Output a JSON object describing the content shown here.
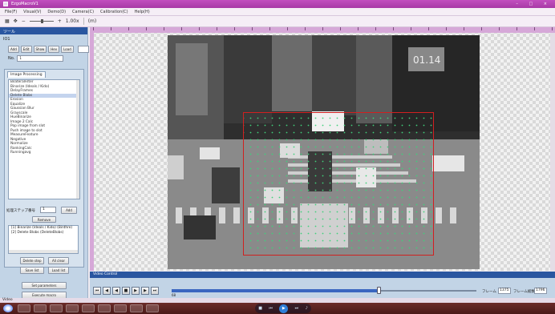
{
  "window": {
    "title": "EzgoMacroV1",
    "controls": "– □ ×"
  },
  "menu": [
    "File(F)",
    "Visual(V)",
    "Demo(D)",
    "Camera(C)",
    "Calibration(C)",
    "Help(H)"
  ],
  "toolbar": {
    "zoom_label": "1.00x",
    "extra_label": "(m)"
  },
  "left_panel": {
    "header": "ツール",
    "tool_label": "IO1",
    "buttons": [
      "Add",
      "Edit",
      "Show",
      "Hev",
      "Load"
    ],
    "no_label": "No.",
    "no_value": "1",
    "ip_tab": "Image Processing",
    "ip_items": [
      "BilateralFilter",
      "Binarize (Ideals / Kido)",
      "DelayFrames",
      "Delete Blobs",
      "Erosion",
      "Equalize",
      "Gaussian Blur",
      "Grayscale",
      "HueBinarize",
      "Image 2 Calc",
      "Pop image from slot",
      "Push image to slot",
      "MeasureFeature",
      "Negative",
      "Normalize",
      "RankingCalc",
      "Runningavg"
    ],
    "selected_item": 3,
    "filter_label": "処理ステップ番号",
    "filter_num": "1",
    "add_label": "Add",
    "remove_label": "Remove",
    "steps": [
      "[1] Binarize (Ideals / Kido) (Binthre)",
      "[2] Delete Blobs (DeleteBlobs)"
    ],
    "delete_label": "Delete step",
    "clear_label": "All clear",
    "save_label": "Save list",
    "load_label": "Load list",
    "setparams_label": "Set parameters",
    "exec_label": "Execute macro"
  },
  "video": {
    "header": "Video Control",
    "frame_label": "フレーム",
    "frame_value": "1375",
    "total_label": "フレーム総数",
    "total_value": "1796",
    "progress": 0.68,
    "small_value": "68"
  },
  "status": {
    "text": "Video"
  }
}
